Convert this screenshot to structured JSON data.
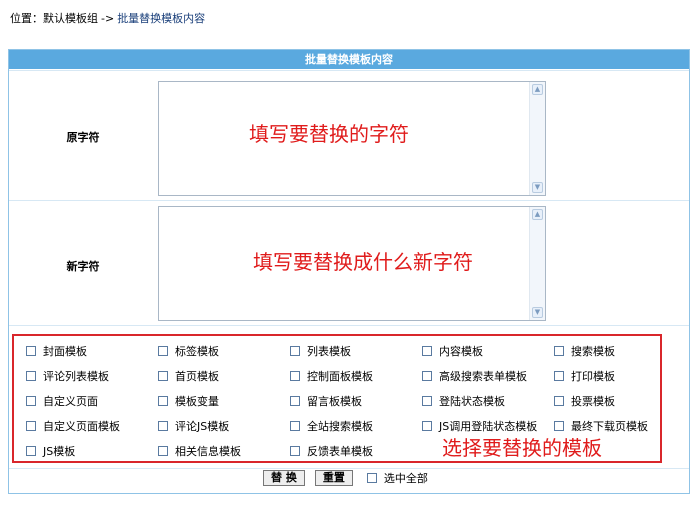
{
  "breadcrumb": {
    "label": "位置：",
    "group": "默认模板组",
    "separator": "->",
    "current": "批量替换模板内容"
  },
  "panel": {
    "title": "批量替换模板内容"
  },
  "fields": {
    "old_label": "原字符",
    "new_label": "新字符"
  },
  "annotations": {
    "old_hint": "填写要替换的字符",
    "new_hint": "填写要替换成什么新字符",
    "templates_hint": "选择要替换的模板",
    "color": "#e01b1b"
  },
  "templates": [
    [
      "封面模板",
      "标签模板",
      "列表模板",
      "内容模板",
      "搜索模板"
    ],
    [
      "评论列表模板",
      "首页模板",
      "控制面板模板",
      "高级搜索表单模板",
      "打印模板"
    ],
    [
      "自定义页面",
      "模板变量",
      "留言板模板",
      "登陆状态模板",
      "投票模板"
    ],
    [
      "自定义页面模板",
      "评论JS模板",
      "全站搜索模板",
      "JS调用登陆状态模板",
      "最终下载页模板"
    ],
    [
      "JS模板",
      "相关信息模板",
      "反馈表单模板"
    ]
  ],
  "buttons": {
    "replace": "替 换",
    "reset": "重置",
    "select_all": "选中全部"
  },
  "colors": {
    "header": "#5aa9df",
    "border": "#8fc3e6",
    "highlight": "#d9262b"
  }
}
